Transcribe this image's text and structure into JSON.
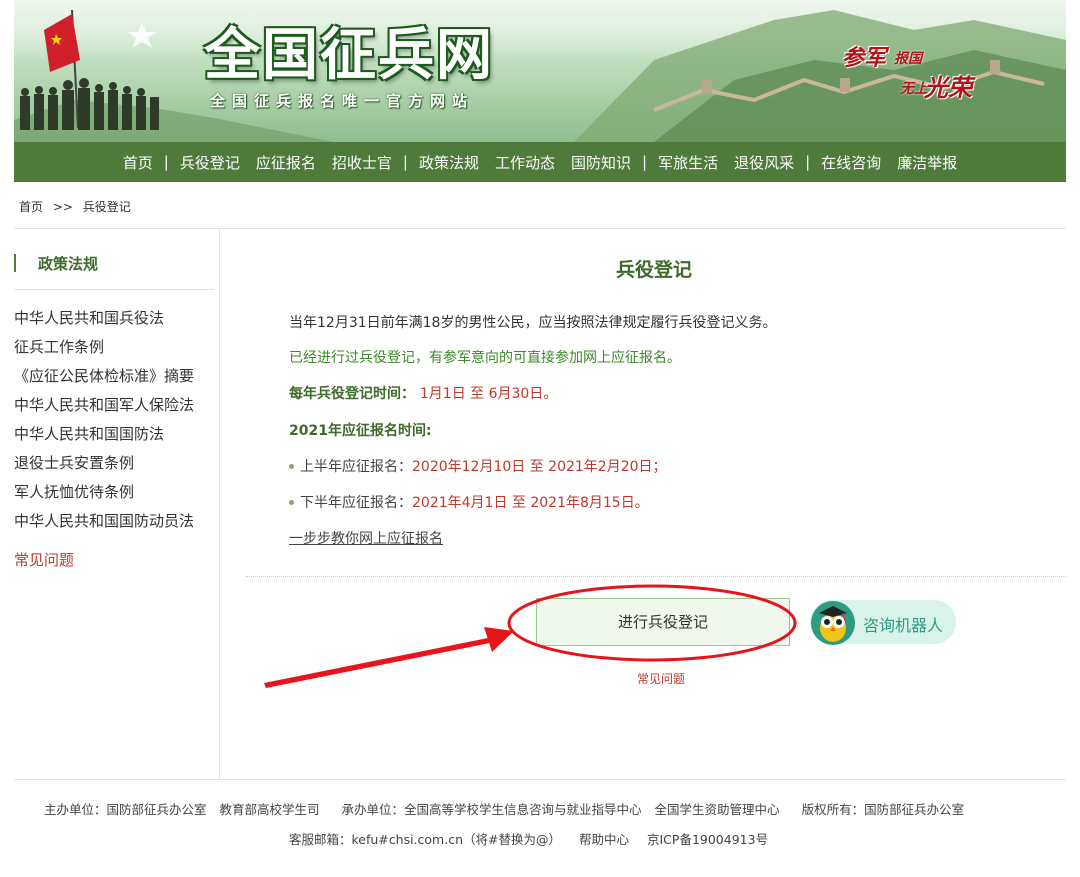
{
  "brand": {
    "logo": "全国征兵网",
    "subtitle": "全国征兵报名唯一官方网站",
    "slogan": {
      "part1": "参军",
      "part2": "报国",
      "part3": "无上",
      "part4": "光荣"
    }
  },
  "nav": {
    "items": [
      "首页",
      "兵役登记",
      "应征报名",
      "招收士官",
      "政策法规",
      "工作动态",
      "国防知识",
      "军旅生活",
      "退役风采",
      "在线咨询",
      "廉洁举报"
    ],
    "separator": "|"
  },
  "breadcrumb": {
    "home": "首页",
    "sep": ">>",
    "current": "兵役登记"
  },
  "sidebar": {
    "title": "政策法规",
    "items": [
      "中华人民共和国兵役法",
      "征兵工作条例",
      "《应征公民体检标准》摘要",
      "中华人民共和国军人保险法",
      "中华人民共和国国防法",
      "退役士兵安置条例",
      "军人抚恤优待条例",
      "中华人民共和国国防动员法"
    ],
    "faq": "常见问题"
  },
  "main": {
    "title": "兵役登记",
    "line1": "当年12月31日前年满18岁的男性公民，应当按照法律规定履行兵役登记义务。",
    "line2": "已经进行过兵役登记，有参军意向的可直接参加网上应征报名。",
    "reg_time_label": "每年兵役登记时间：",
    "reg_time_value": "1月1日 至 6月30日。",
    "apply_time_label": "2021年应征报名时间:",
    "first_half_label": "上半年应征报名：",
    "first_half_value": "2020年12月10日 至 2021年2月20日；",
    "second_half_label": "下半年应征报名：",
    "second_half_value": "2021年4月1日 至 2021年8月15日。",
    "guide_link": "一步步教你网上应征报名",
    "register_button": "进行兵役登记",
    "faq_link": "常见问题",
    "robot_button": "咨询机器人"
  },
  "footer": {
    "sponsor": "主办单位：国防部征兵办公室",
    "sponsor2": "教育部高校学生司",
    "organizer": "承办单位：全国高等学校学生信息咨询与就业指导中心",
    "organizer2": "全国学生资助管理中心",
    "copyright": "版权所有：国防部征兵办公室",
    "email": "客服邮箱：kefu#chsi.com.cn（将#替换为@）",
    "help": "帮助中心",
    "icp": "京ICP备19004913号"
  },
  "colors": {
    "nav_green": "#4f7b3a",
    "title_green": "#3d6b2a",
    "link_red": "#c0392b",
    "annotation_red": "#e8141c"
  }
}
